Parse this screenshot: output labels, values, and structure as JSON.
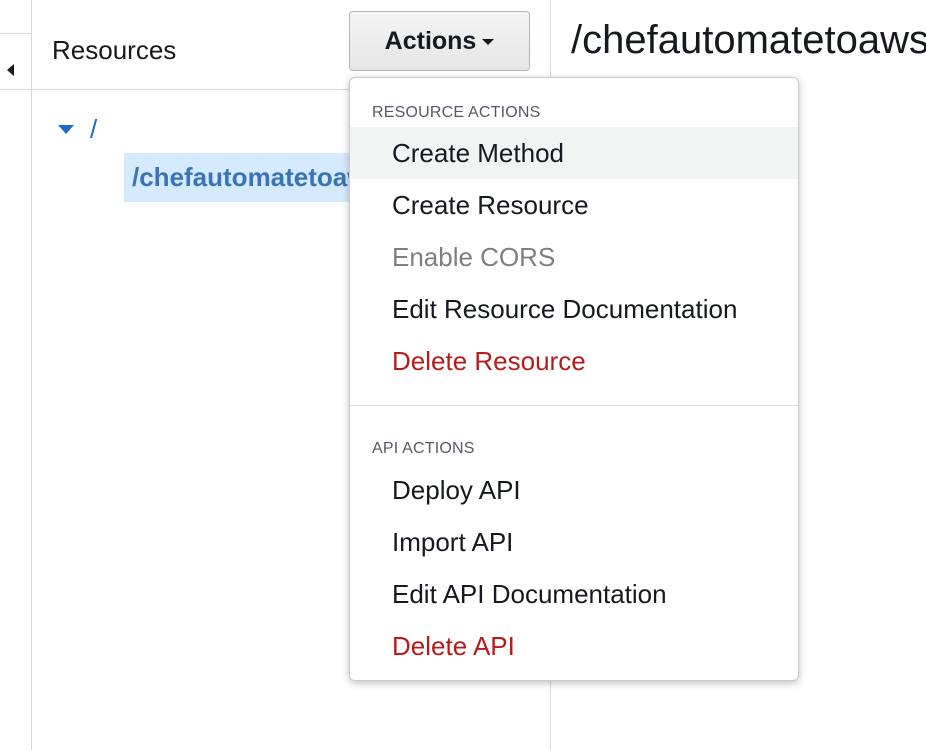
{
  "resources_panel": {
    "title": "Resources",
    "actions_button": "Actions"
  },
  "tree": {
    "root_path": "/",
    "child_path": "/chefautomatetoaws"
  },
  "content": {
    "title": "/chefautomatetoaws"
  },
  "dropdown": {
    "resource_actions": {
      "heading": "RESOURCE ACTIONS",
      "items": [
        {
          "label": "Create Method"
        },
        {
          "label": "Create Resource"
        },
        {
          "label": "Enable CORS"
        },
        {
          "label": "Edit Resource Documentation"
        },
        {
          "label": "Delete Resource"
        }
      ]
    },
    "api_actions": {
      "heading": "API ACTIONS",
      "items": [
        {
          "label": "Deploy API"
        },
        {
          "label": "Import API"
        },
        {
          "label": "Edit API Documentation"
        },
        {
          "label": "Delete API"
        }
      ]
    }
  },
  "colors": {
    "link_blue": "#1b6cc4",
    "selected_bg": "#d6eafd",
    "danger_red": "#b81b1b",
    "disabled_gray": "#7f7f7f"
  }
}
